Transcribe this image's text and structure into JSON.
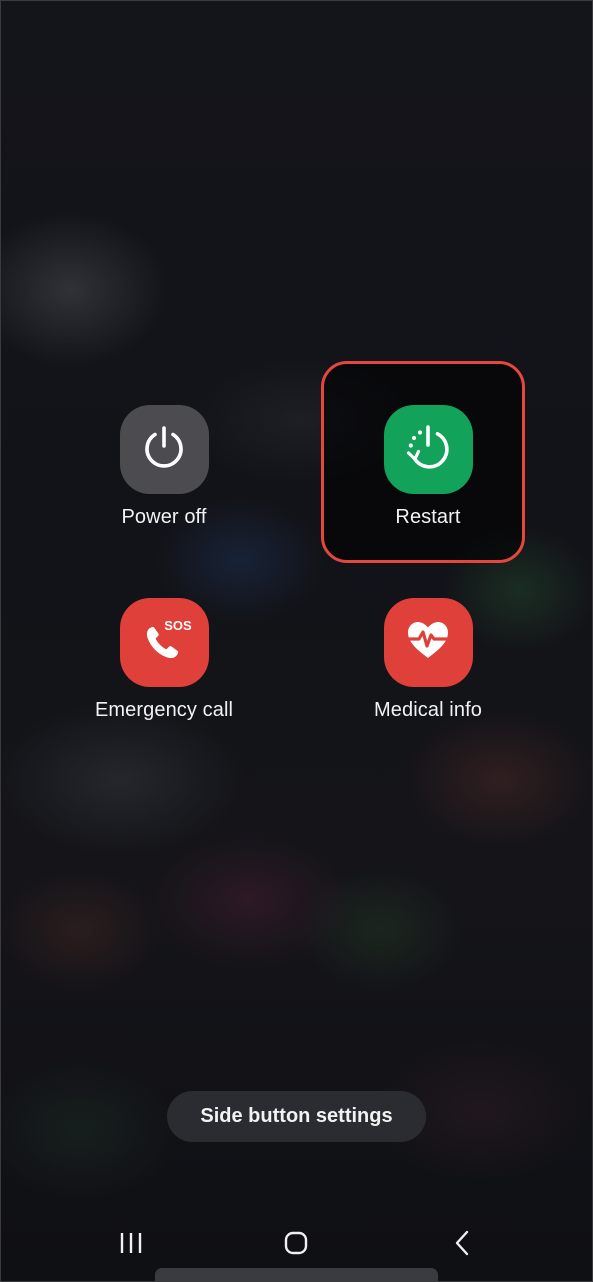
{
  "power_menu": {
    "power_off": {
      "label": "Power off",
      "icon": "power-icon",
      "color": "#4b4b50"
    },
    "restart": {
      "label": "Restart",
      "icon": "restart-icon",
      "color": "#12a25a"
    },
    "emergency_call": {
      "label": "Emergency call",
      "icon": "sos-phone-icon",
      "badge": "SOS",
      "color": "#e0403a"
    },
    "medical_info": {
      "label": "Medical info",
      "icon": "heart-pulse-icon",
      "color": "#e0403a"
    }
  },
  "highlight": {
    "target": "restart",
    "color": "#e6473d"
  },
  "side_button_settings": {
    "label": "Side button settings"
  },
  "nav_bar": {
    "recents": "recents-icon",
    "home": "home-icon",
    "back": "back-icon"
  }
}
